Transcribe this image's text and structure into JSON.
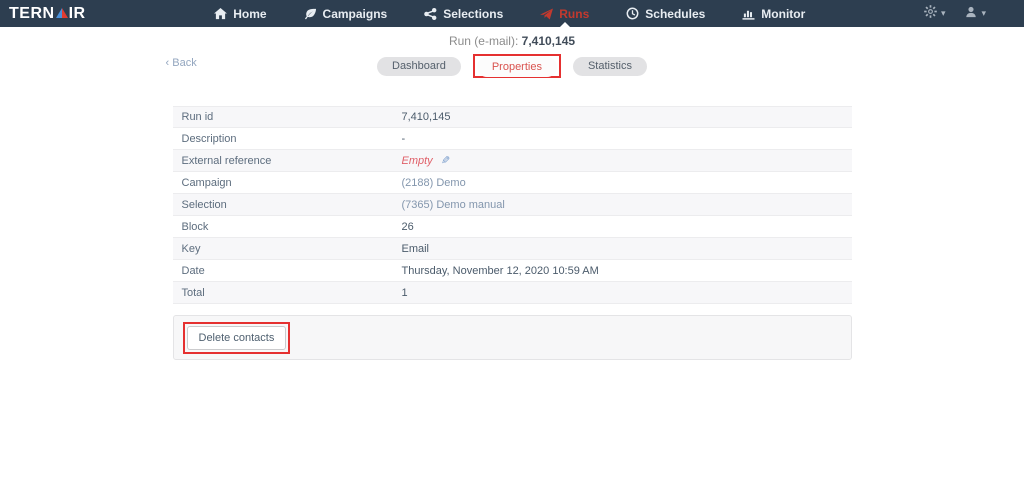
{
  "navbar": {
    "brand": {
      "text_left": "TERN",
      "text_right": "IR"
    },
    "items": [
      {
        "label": "Home",
        "icon": "home-icon",
        "active": false
      },
      {
        "label": "Campaigns",
        "icon": "campaigns-icon",
        "active": false
      },
      {
        "label": "Selections",
        "icon": "selections-icon",
        "active": false
      },
      {
        "label": "Runs",
        "icon": "runs-icon",
        "active": true
      },
      {
        "label": "Schedules",
        "icon": "schedules-icon",
        "active": false
      },
      {
        "label": "Monitor",
        "icon": "monitor-icon",
        "active": false
      }
    ],
    "caret_glyph": "▾"
  },
  "page": {
    "title_prefix": "Run (e-mail):",
    "title_value": "7,410,145",
    "back_chevron": "‹",
    "back_label": "Back",
    "tabs": [
      {
        "label": "Dashboard"
      },
      {
        "label": "Properties"
      },
      {
        "label": "Statistics"
      }
    ]
  },
  "properties": {
    "rows": [
      {
        "label": "Run id",
        "value": "7,410,145"
      },
      {
        "label": "Description",
        "value": "-"
      },
      {
        "label": "External reference",
        "value": "Empty"
      },
      {
        "label": "Campaign",
        "value": "(2188) Demo"
      },
      {
        "label": "Selection",
        "value": "(7365) Demo manual"
      },
      {
        "label": "Block",
        "value": "26"
      },
      {
        "label": "Key",
        "value": "Email"
      },
      {
        "label": "Date",
        "value": "Thursday, November 12, 2020 10:59 AM"
      },
      {
        "label": "Total",
        "value": "1"
      }
    ],
    "pencil_glyph": "✎"
  },
  "footer": {
    "delete_button_label": "Delete contacts"
  },
  "colors": {
    "navbar_bg": "#2d3e50",
    "active_nav": "#c3392e",
    "annotation_red": "#e53030",
    "empty_red": "#e06069",
    "link_blue_gray": "#8396ad",
    "logo_triangle_blue": "#4a90d9",
    "logo_triangle_red": "#e03c31"
  }
}
